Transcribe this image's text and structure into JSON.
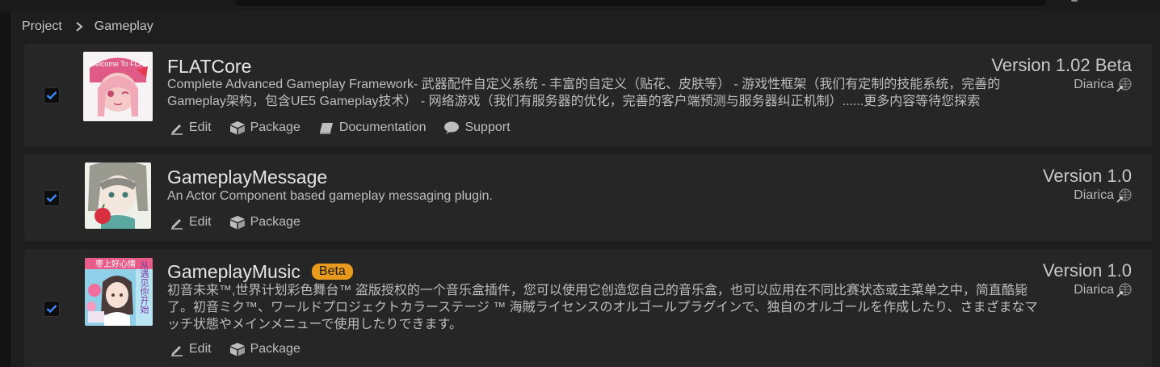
{
  "breadcrumb": {
    "root": "Project",
    "current": "Gameplay"
  },
  "colors": {
    "background": "#1e1e1e",
    "card": "#262626",
    "checkbox_accent": "#1c6bd6",
    "beta_badge": "#e89a1d"
  },
  "actions": {
    "edit": "Edit",
    "package": "Package",
    "documentation": "Documentation",
    "support": "Support"
  },
  "plugins": [
    {
      "enabled": true,
      "title": "FLATCore",
      "description": "Complete Advanced Gameplay Framework- 武器配件自定义系统 - 丰富的自定义（贴花、皮肤等） - 游戏性框架（我们有定制的技能系统，完善的Gameplay架构，包含UE5 Gameplay技术） - 网络游戏（我们有服务器的优化，完善的客户端预测与服务器纠正机制）......更多内容等待您探索",
      "version": "Version 1.02 Beta",
      "author": "Diarica",
      "thumb_caption": "Welcome To FLAT"
    },
    {
      "enabled": true,
      "title": "GameplayMessage",
      "description": "An Actor Component based gameplay messaging plugin.",
      "version": "Version 1.0",
      "author": "Diarica"
    },
    {
      "enabled": true,
      "title": "GameplayMusic",
      "badge": "Beta",
      "description": "初音未来™,世界计划彩色舞台™ 盗版授权的一个音乐盒插件，您可以使用它创造您自己的音乐盒，也可以应用在不同比赛状态或主菜单之中，简直酷毙了。初音ミク™、ワールドプロジェクトカラーステージ ™ 海賊ライセンスのオルゴールプラグインで、独自のオルゴールを作成したり、さまざまなマッチ状態やメインメニューで使用したりできます。",
      "version": "Version 1.0",
      "author": "Diarica",
      "thumb_caption_top": "枣上好心情",
      "thumb_caption_side": "从遇见你开始"
    }
  ]
}
